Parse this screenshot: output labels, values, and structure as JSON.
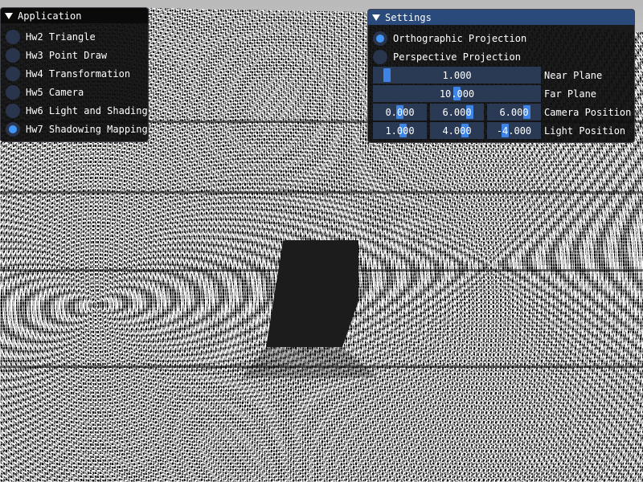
{
  "app_window": {
    "title": "Application",
    "items": [
      {
        "label": "Hw2 Triangle",
        "selected": false
      },
      {
        "label": "Hw3 Point Draw",
        "selected": false
      },
      {
        "label": "Hw4 Transformation",
        "selected": false
      },
      {
        "label": "Hw5 Camera",
        "selected": false
      },
      {
        "label": "Hw6 Light and Shading",
        "selected": false
      },
      {
        "label": "Hw7 Shadowing Mapping",
        "selected": true
      }
    ]
  },
  "settings_window": {
    "title": "Settings",
    "projection": [
      {
        "label": "Orthographic Projection",
        "selected": true
      },
      {
        "label": "Perspective Projection",
        "selected": false
      }
    ],
    "near_plane": {
      "label": "Near Plane",
      "value": "1.000"
    },
    "far_plane": {
      "label": "Far Plane",
      "value": "10.000"
    },
    "camera_position": {
      "label": "Camera Position",
      "values": [
        "0.000",
        "6.000",
        "6.000"
      ]
    },
    "light_position": {
      "label": "Light Position",
      "values": [
        "1.000",
        "4.000",
        "-4.000"
      ]
    }
  },
  "colors": {
    "accent": "#4296fa",
    "title_active": "#294a7a",
    "frame_bg": "#2a3a55"
  }
}
